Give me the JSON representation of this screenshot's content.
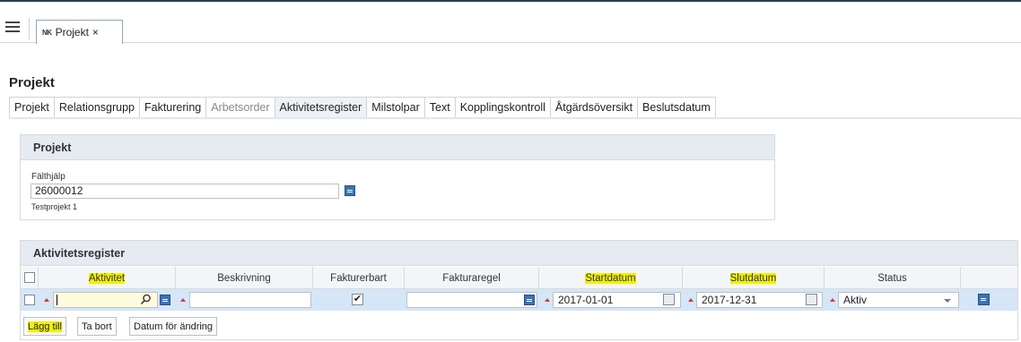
{
  "doc_tab": {
    "logo": "NK",
    "title": "Projekt",
    "close": "×"
  },
  "page_title": "Projekt",
  "tabs": [
    {
      "label": "Projekt"
    },
    {
      "label": "Relationsgrupp"
    },
    {
      "label": "Fakturering"
    },
    {
      "label": "Arbetsorder"
    },
    {
      "label": "Aktivitetsregister"
    },
    {
      "label": "Milstolpar"
    },
    {
      "label": "Text"
    },
    {
      "label": "Kopplingskontroll"
    },
    {
      "label": "Åtgärdsöversikt"
    },
    {
      "label": "Beslutsdatum"
    }
  ],
  "active_tab": "Aktivitetsregister",
  "project_panel": {
    "title": "Projekt",
    "field_label": "Fälthjälp",
    "field_value": "26000012",
    "description": "Testprojekt 1"
  },
  "activity_panel": {
    "title": "Aktivitetsregister",
    "columns": {
      "aktivitet": "Aktivitet",
      "beskrivning": "Beskrivning",
      "fakturerbart": "Fakturerbart",
      "fakturaregel": "Fakturaregel",
      "startdatum": "Startdatum",
      "slutdatum": "Slutdatum",
      "status": "Status"
    },
    "row": {
      "aktivitet": "",
      "beskrivning": "",
      "fakturerbart_mark": "✔",
      "fakturaregel": "",
      "startdatum": "2017-01-01",
      "slutdatum": "2017-12-31",
      "status": "Aktiv"
    },
    "buttons": {
      "add": "Lägg till",
      "delete": "Ta bort",
      "date_change": "Datum för ändring"
    }
  },
  "colors": {
    "highlight": "#f2f200",
    "row_bg": "#d5e6f7",
    "header_bg": "#e6ebf1",
    "accent": "#3a73b8"
  }
}
